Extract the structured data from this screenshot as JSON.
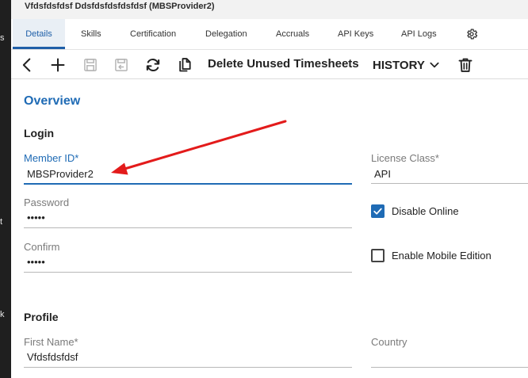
{
  "left_strip": {
    "glyphs": [
      "s",
      "t",
      "k"
    ]
  },
  "window": {
    "title": "Vfdsfdsfdsf Ddsfdsfdsfdsfdsf (MBSProvider2)"
  },
  "tabs": [
    {
      "label": "Details",
      "active": true
    },
    {
      "label": "Skills"
    },
    {
      "label": "Certification"
    },
    {
      "label": "Delegation"
    },
    {
      "label": "Accruals"
    },
    {
      "label": "API Keys"
    },
    {
      "label": "API Logs"
    }
  ],
  "toolbar": {
    "delete_unused_label": "Delete Unused Timesheets",
    "history_label": "HISTORY"
  },
  "page": {
    "overview_title": "Overview"
  },
  "login": {
    "heading": "Login",
    "member_id": {
      "label": "Member ID*",
      "value": "MBSProvider2"
    },
    "password": {
      "label": "Password",
      "value": "•••••"
    },
    "confirm": {
      "label": "Confirm",
      "value": "•••••"
    },
    "license_class": {
      "label": "License Class*",
      "value": "API"
    },
    "disable_online": {
      "label": "Disable Online",
      "checked": true
    },
    "enable_mobile": {
      "label": "Enable Mobile Edition",
      "checked": false
    }
  },
  "profile": {
    "heading": "Profile",
    "first_name": {
      "label": "First Name*",
      "value": "Vfdsfdsfdsf"
    },
    "country": {
      "label": "Country",
      "value": ""
    }
  },
  "colors": {
    "accent": "#1f6bb5",
    "annotation": "#e31b1b"
  }
}
